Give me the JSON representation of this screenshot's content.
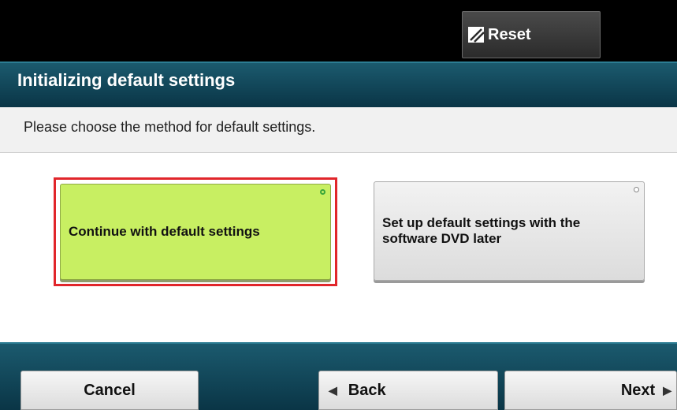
{
  "header": {
    "reset_label": "Reset"
  },
  "title": "Initializing default settings",
  "instruction": "Please choose the method for default settings.",
  "options": [
    {
      "label": "Continue with default settings",
      "selected": true
    },
    {
      "label": "Set up default settings with the software DVD later",
      "selected": false
    }
  ],
  "footer": {
    "cancel_label": "Cancel",
    "back_label": "Back",
    "next_label": "Next"
  },
  "colors": {
    "title_bar": "#0a3546",
    "selected_option": "#c8ef62",
    "selection_border": "#e1262b"
  }
}
